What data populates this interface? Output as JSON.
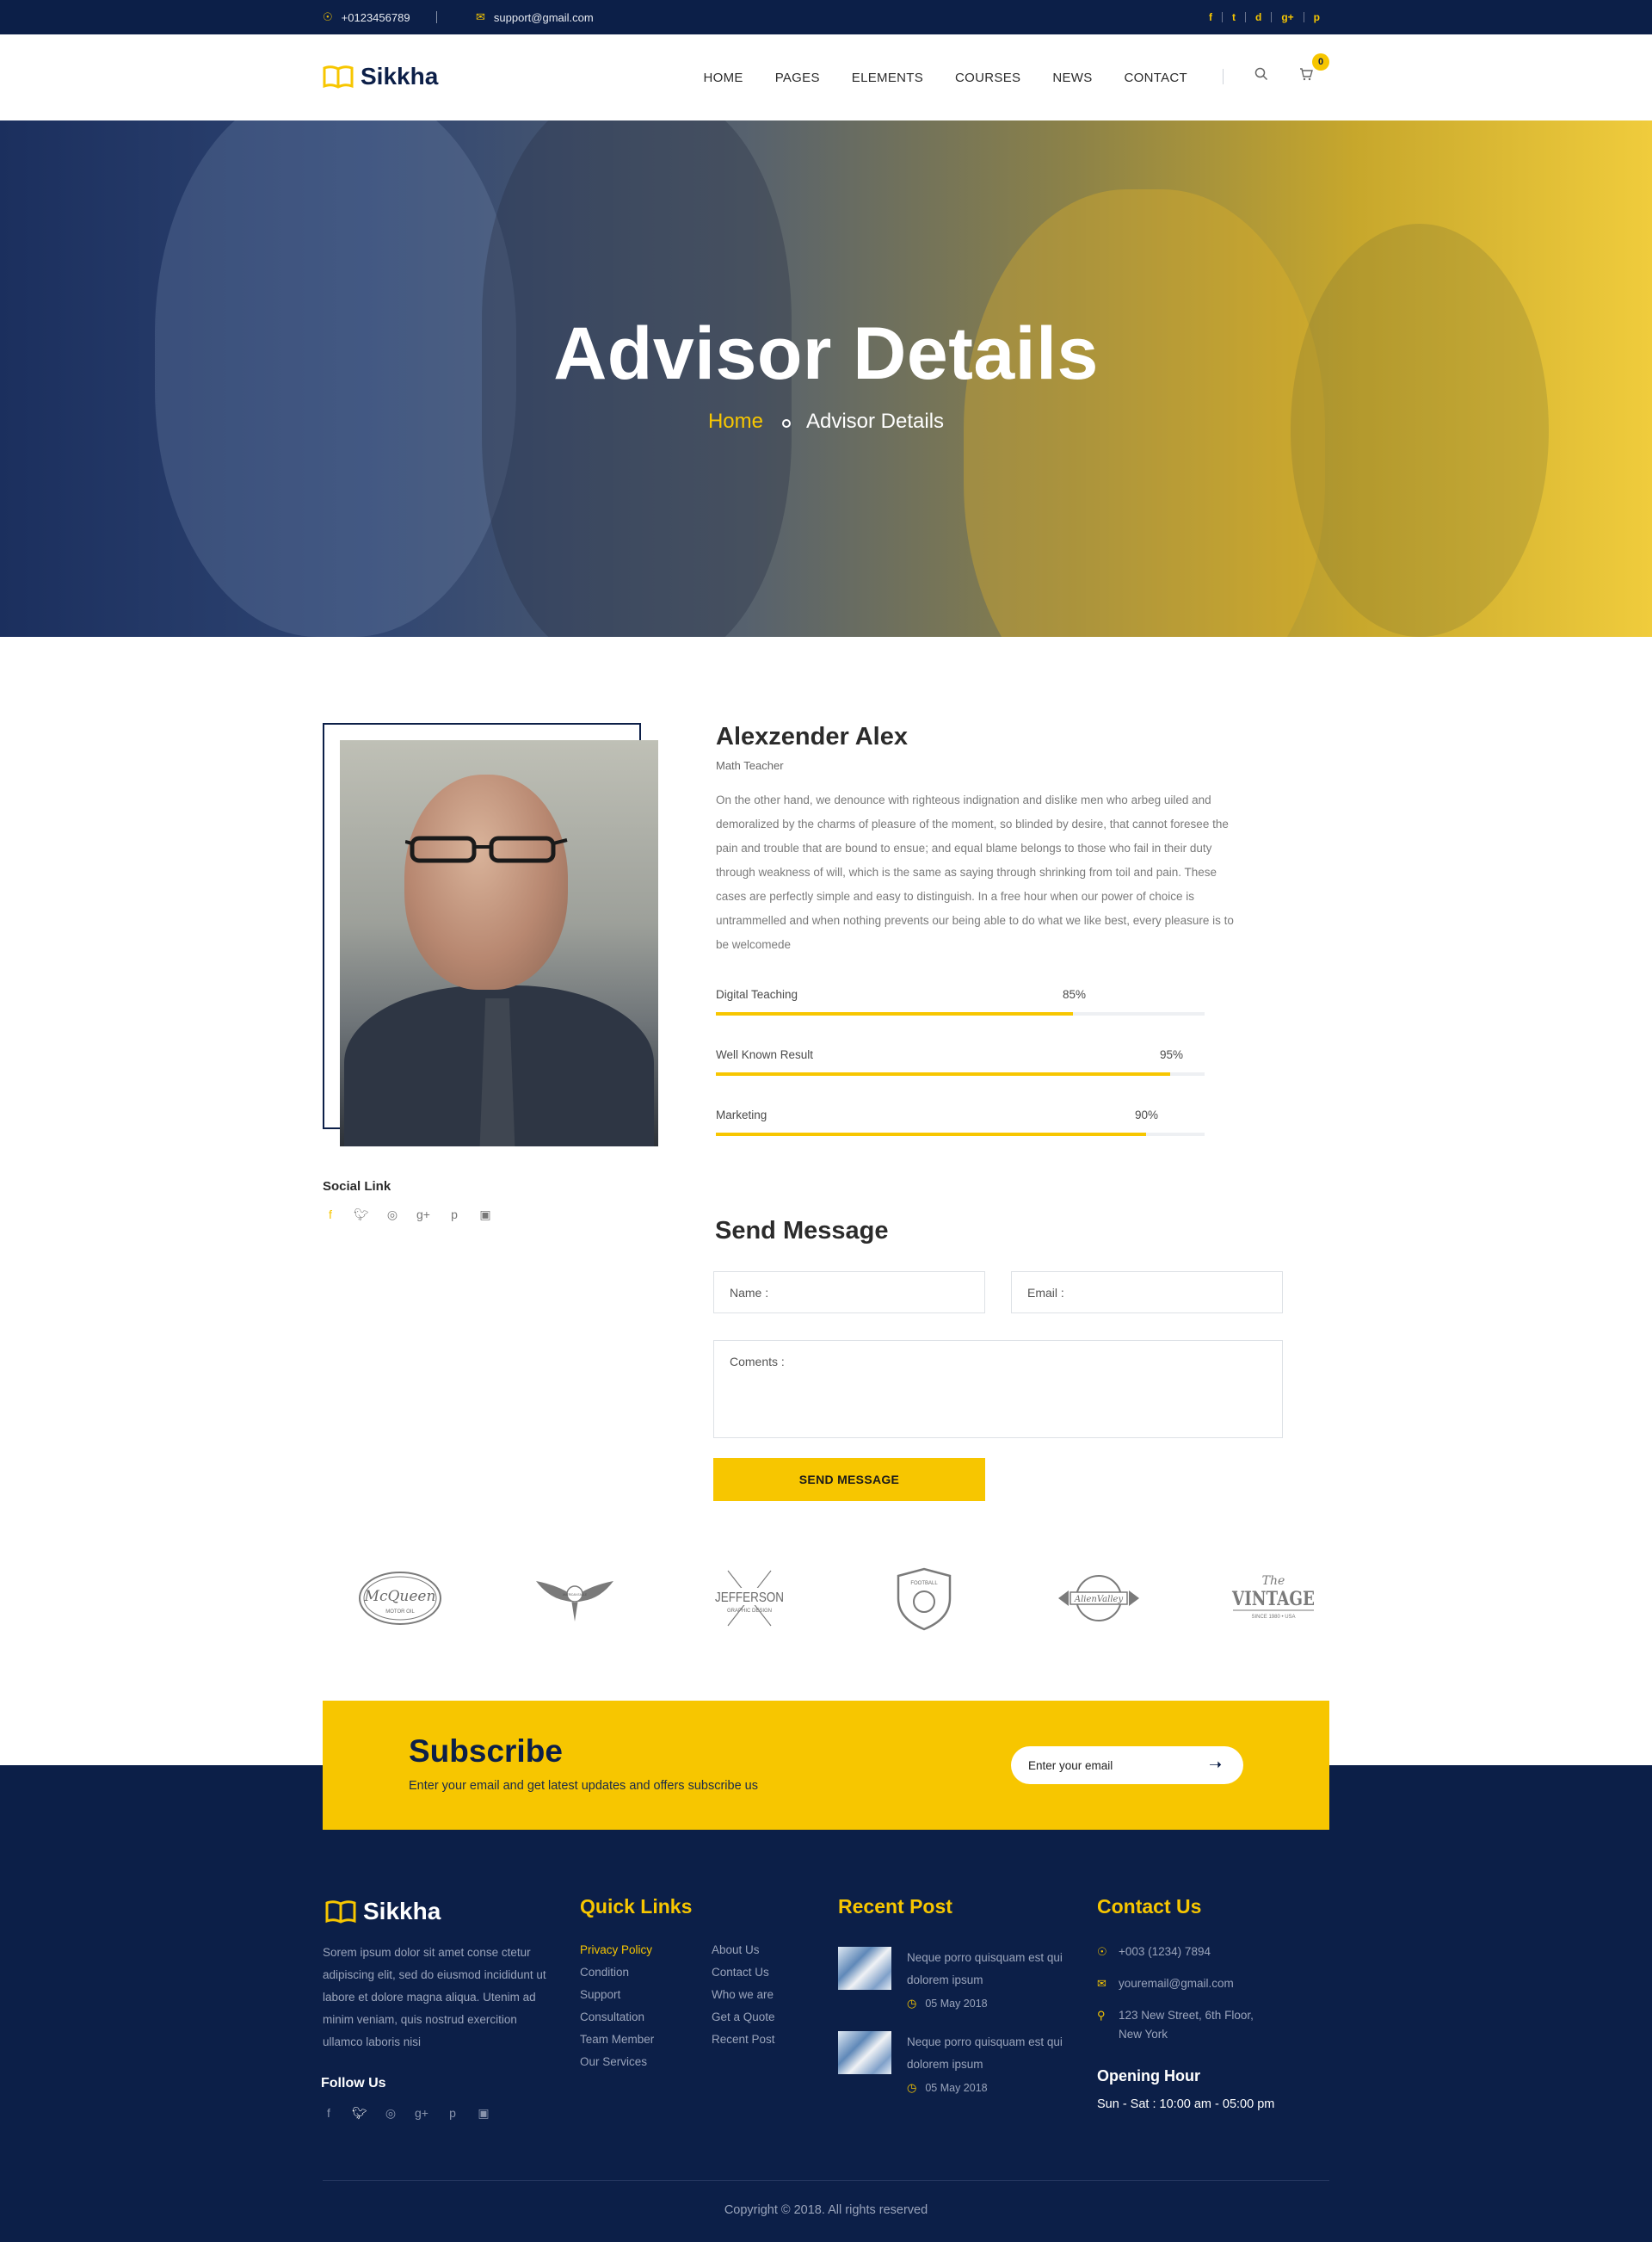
{
  "topbar": {
    "phone": "+0123456789",
    "email": "support@gmail.com",
    "social": [
      "f",
      "t",
      "d",
      "g+",
      "p"
    ]
  },
  "header": {
    "logo_text": "Sikkha",
    "nav": [
      "HOME",
      "PAGES",
      "ELEMENTS",
      "COURSES",
      "NEWS",
      "CONTACT"
    ],
    "cart_count": "0"
  },
  "hero": {
    "title": "Advisor Details",
    "breadcrumb_home": "Home",
    "breadcrumb_current": "Advisor Details"
  },
  "advisor": {
    "name": "Alexzender Alex",
    "role": "Math Teacher",
    "bio": "On the other hand, we denounce with righteous indignation and dislike men who arbeg uiled and demoralized by the charms of pleasure of the moment, so blinded by desire, that cannot foresee the pain and trouble that are bound to ensue; and equal blame belongs to those who fail in their duty through weakness of will, which is the same as saying through shrinking from toil and pain. These cases are perfectly simple and easy to distinguish. In a free hour when our power of choice is untrammelled and when nothing prevents our being able to do what we like best, every pleasure is to be welcomede",
    "skills": [
      {
        "label": "Digital Teaching",
        "pct": "85%",
        "value": 0.73
      },
      {
        "label": "Well Known Result",
        "pct": "95%",
        "value": 0.93
      },
      {
        "label": "Marketing",
        "pct": "90%",
        "value": 0.88
      }
    ],
    "social_link_title": "Social Link"
  },
  "message_form": {
    "title": "Send Message",
    "name_placeholder": "Name :",
    "email_placeholder": "Email :",
    "comments_placeholder": "Coments :",
    "button_label": "SEND MESSAGE"
  },
  "brands": {
    "mcqueen_line1": "McQueen",
    "mcqueen_line2": "MOTOR OIL",
    "eagle": "AMERICAN EAGLE",
    "jefferson_line1": "JEFFERSON",
    "jefferson_line2": "GRAPHIC DESIGN",
    "football": "FOOTBALL",
    "alien": "AlienValley",
    "vintage_line1": "The",
    "vintage_line2": "VINTAGE",
    "vintage_line3": "SINCE 1980 • USA"
  },
  "subscribe": {
    "title": "Subscribe",
    "text": "Enter  your email and get latest updates and offers subscribe us",
    "placeholder": "Enter your email"
  },
  "footer": {
    "logo_text": "Sikkha",
    "about": "Sorem ipsum dolor sit amet conse ctetur adipiscing elit, sed do eiusmod  incididunt ut labore et dolore magna aliqua. Utenim ad minim veniam, quis nostrud exercition ullamco laboris nisi",
    "follow_title": "Follow Us",
    "quick_links_title": "Quick Links",
    "quick_links_col1": [
      "Privacy Policy",
      "Condition",
      "Support",
      "Consultation",
      "Team Member",
      "Our Services"
    ],
    "quick_links_col2": [
      "About Us",
      "Contact Us",
      "Who we are",
      "Get a Quote",
      "Recent Post"
    ],
    "recent_post_title": "Recent Post",
    "posts": [
      {
        "title": "Neque porro quisquam est qui dolorem ipsum",
        "date": "05 May 2018"
      },
      {
        "title": "Neque porro quisquam est qui dolorem ipsum",
        "date": "05 May 2018"
      }
    ],
    "contact_title": "Contact Us",
    "contact_phone": "+003 (1234) 7894",
    "contact_email": "youremail@gmail.com",
    "contact_address": "123 New Street, 6th Floor, New York",
    "opening_title": "Opening Hour",
    "opening_time": "Sun - Sat : 10:00 am - 05:00 pm",
    "copyright": "Copyright © 2018. All rights reserved"
  }
}
